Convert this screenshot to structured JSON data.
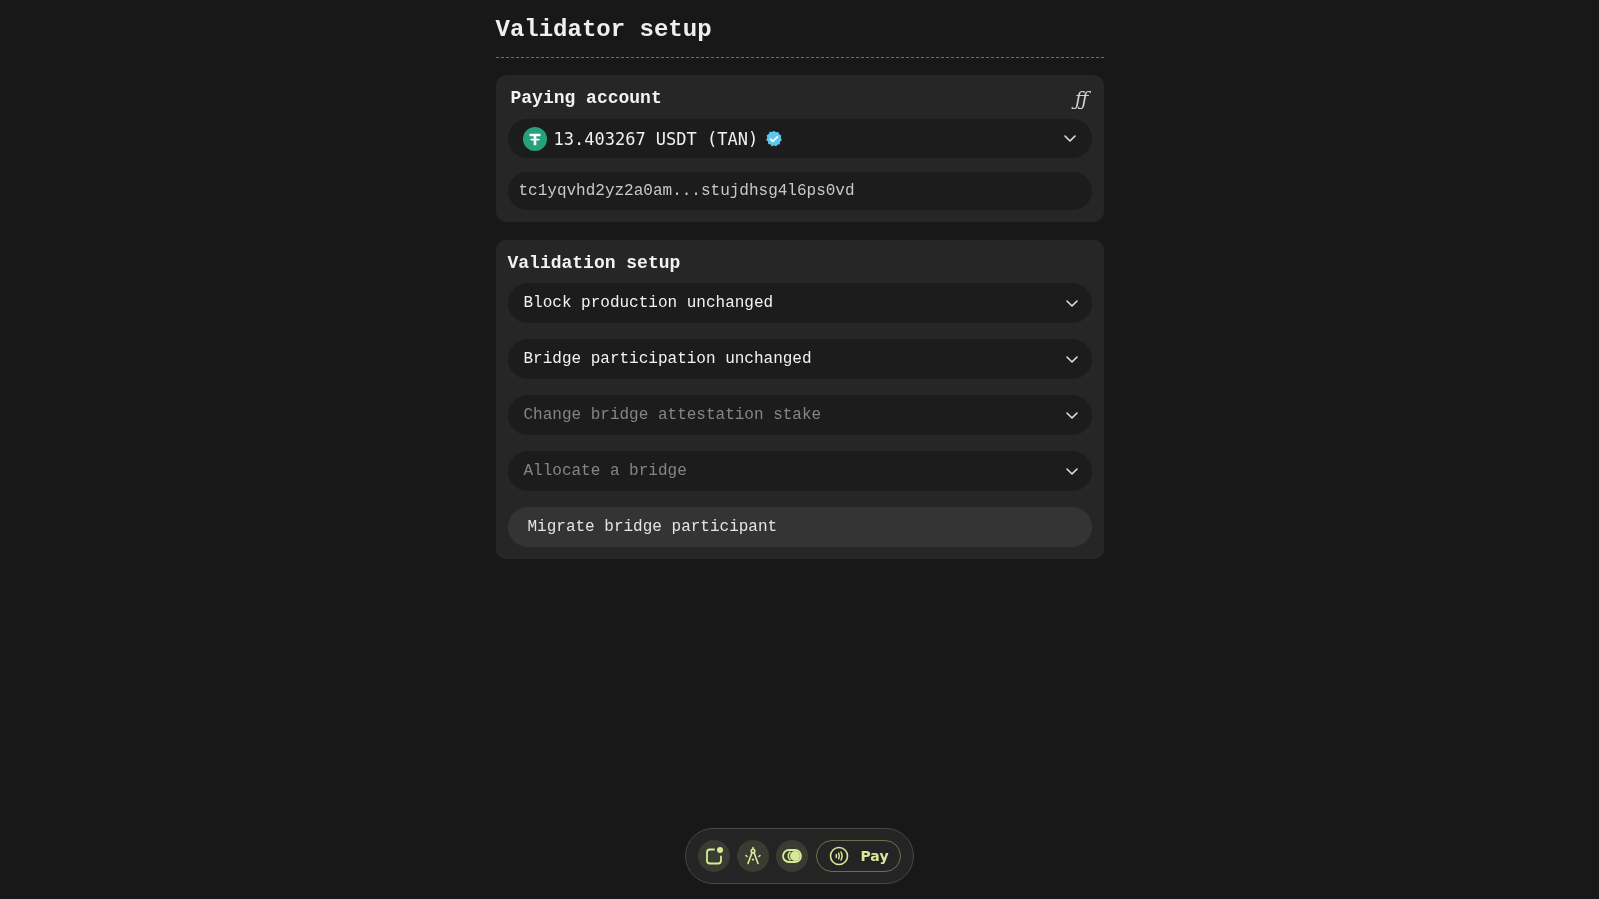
{
  "page": {
    "title": "Validator setup"
  },
  "paying_account": {
    "title": "Paying account",
    "symbol": "ƒƒ",
    "account": {
      "balance": "13.403267 USDT (TAN)",
      "verified": true
    },
    "address": "tc1yqvhd2yz2a0am...stujdhsg4l6ps0vd"
  },
  "validation_setup": {
    "title": "Validation setup",
    "items": [
      {
        "kind": "select",
        "label": "Block production unchanged",
        "disabled": false
      },
      {
        "kind": "select",
        "label": "Bridge participation unchanged",
        "disabled": false
      },
      {
        "kind": "select",
        "label": "Change bridge attestation stake",
        "disabled": true
      },
      {
        "kind": "select",
        "label": "Allocate a bridge",
        "disabled": true
      },
      {
        "kind": "button",
        "label": "Migrate bridge participant",
        "disabled": false
      }
    ]
  },
  "toolbar": {
    "pay_button": "Pay"
  }
}
